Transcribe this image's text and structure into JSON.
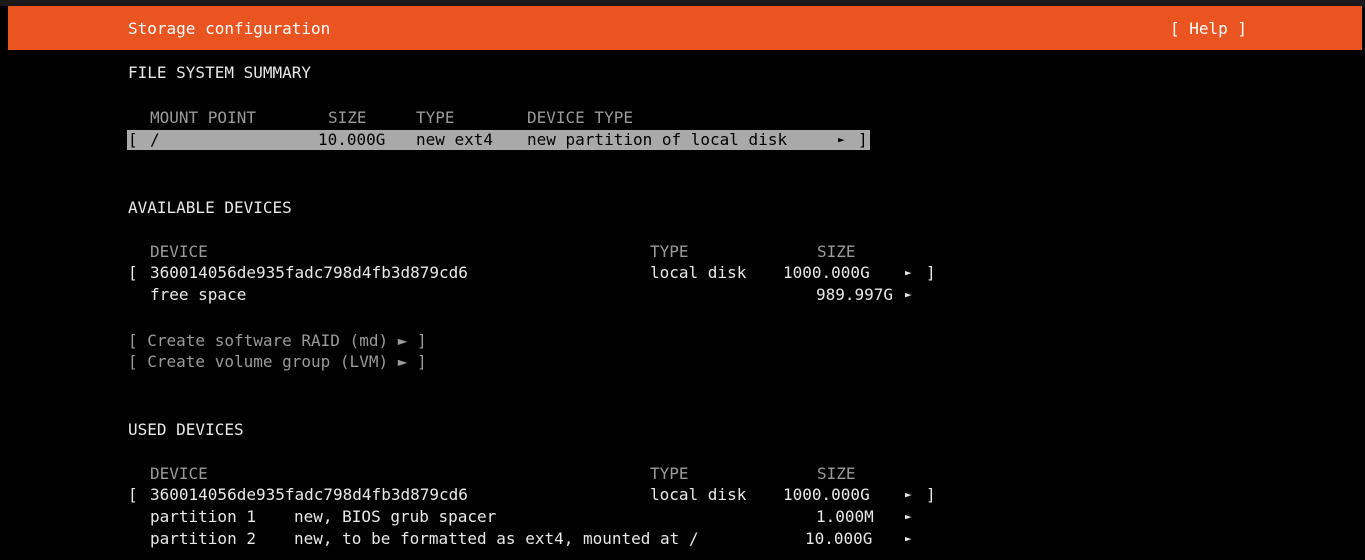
{
  "header": {
    "title": "Storage configuration",
    "help_button": "[ Help ]"
  },
  "filesystem_summary": {
    "heading": "FILE SYSTEM SUMMARY",
    "columns": {
      "mount_point": "MOUNT POINT",
      "size": "SIZE",
      "type": "TYPE",
      "device_type": "DEVICE TYPE"
    },
    "rows": [
      {
        "open_bracket": "[",
        "mount_point": "/",
        "size": "10.000G",
        "type": "new ext4",
        "device_type": "new partition of local disk",
        "arrow": "►",
        "close_bracket": "]"
      }
    ]
  },
  "available_devices": {
    "heading": "AVAILABLE DEVICES",
    "columns": {
      "device": "DEVICE",
      "type": "TYPE",
      "size": "SIZE"
    },
    "disk": {
      "open_bracket": "[",
      "device": "360014056de935fadc798d4fb3d879cd6",
      "type": "local disk",
      "size": "1000.000G",
      "arrow": "►",
      "close_bracket": "]"
    },
    "free_space": {
      "label": "free space",
      "size": "989.997G",
      "arrow": "►"
    },
    "actions": {
      "create_raid": "[ Create software RAID (md) ► ]",
      "create_lvm": "[ Create volume group (LVM) ► ]"
    }
  },
  "used_devices": {
    "heading": "USED DEVICES",
    "columns": {
      "device": "DEVICE",
      "type": "TYPE",
      "size": "SIZE"
    },
    "disk": {
      "open_bracket": "[",
      "device": "360014056de935fadc798d4fb3d879cd6",
      "type": "local disk",
      "size": "1000.000G",
      "arrow": "►",
      "close_bracket": "]"
    },
    "partitions": [
      {
        "label": "partition 1",
        "description": "new, BIOS grub spacer",
        "size": "1.000M",
        "arrow": "►"
      },
      {
        "label": "partition 2",
        "description": "new, to be formatted as ext4, mounted at /",
        "size": "10.000G",
        "arrow": "►"
      }
    ]
  },
  "colors": {
    "header_bg": "#e95420",
    "background": "#000000",
    "selection_bg": "#a9a9a9",
    "text": "#e8e8e8",
    "dim_text": "#9a9a9a"
  }
}
